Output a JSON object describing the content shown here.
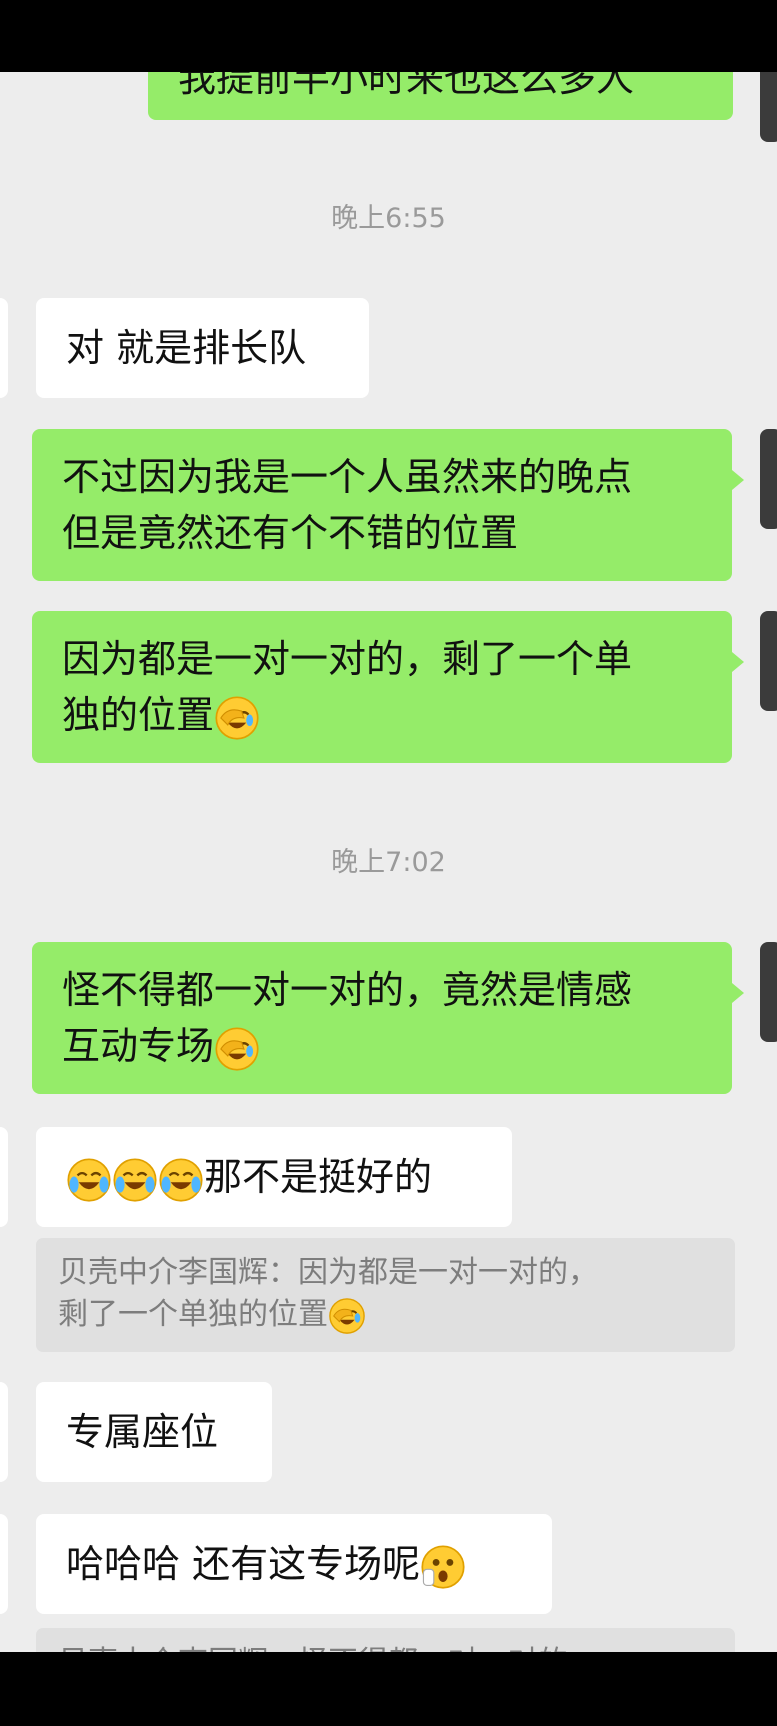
{
  "messages": {
    "m0": "我提前半小时来也这么多人",
    "t1": "晚上6:55",
    "m1": "对 就是排长队",
    "m2_l1": "不过因为我是一个人虽然来的晚点",
    "m2_l2": "但是竟然还有个不错的位置",
    "m3_l1": "因为都是一对一对的，剩了一个单",
    "m3_l2": "独的位置",
    "t2": "晚上7:02",
    "m4_l1": "怪不得都一对一对的，竟然是情感",
    "m4_l2": "互动专场",
    "m5": "那不是挺好的",
    "q1_l1": "贝壳中介李国辉：因为都是一对一对的，",
    "q1_l2": "剩了一个单独的位置",
    "m6": "专属座位",
    "m7": "哈哈哈 还有这专场呢",
    "q2": "贝壳中介李国辉：怪不得都一对一对的"
  },
  "emoji_names": [
    "facepalm-laugh-emoji",
    "tears-of-joy-emoji",
    "surprised-emoji"
  ]
}
